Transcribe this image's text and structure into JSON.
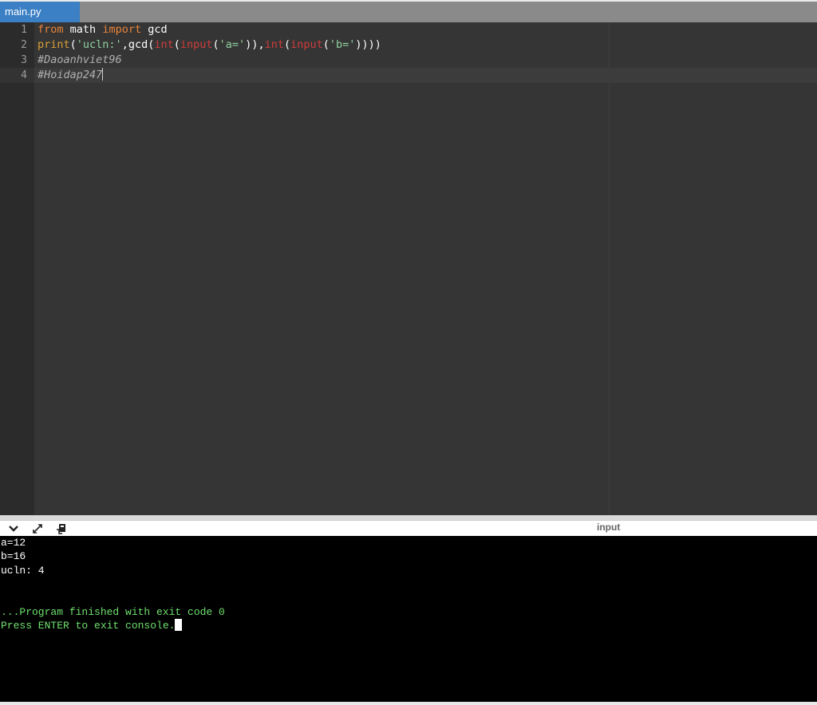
{
  "tab": {
    "label": "main.py"
  },
  "editor": {
    "line_numbers": [
      "1",
      "2",
      "3",
      "4"
    ],
    "lines": {
      "l1": {
        "kw1": "from",
        "mod": "math",
        "kw2": "import",
        "name": "gcd"
      },
      "l2": {
        "print": "print",
        "open1": "(",
        "str1": "'ucln:'",
        "comma1": ",",
        "gcd": "gcd",
        "open2": "(",
        "int1": "int",
        "open3": "(",
        "input1": "input",
        "open4": "(",
        "str2": "'a='",
        "close1": ")),",
        "int2": "int",
        "open5": "(",
        "input2": "input",
        "open6": "(",
        "str3": "'b='",
        "close2": "))))"
      },
      "l3": "#Daoanhviet96",
      "l4": "#Hoidap247"
    }
  },
  "console_toolbar": {
    "collapse_icon": "chevron-down-icon",
    "expand_icon": "expand-icon",
    "clear_icon": "clear-console-icon",
    "input_label": "input"
  },
  "console": {
    "lines": [
      "a=12",
      "b=16",
      "ucln: 4"
    ],
    "finished": "...Program finished with exit code 0",
    "press_enter": "Press ENTER to exit console."
  },
  "colors": {
    "tab_active": "#3b7fc4",
    "editor_bg": "#353535",
    "console_bg": "#000000",
    "console_green": "#6fe06f"
  }
}
